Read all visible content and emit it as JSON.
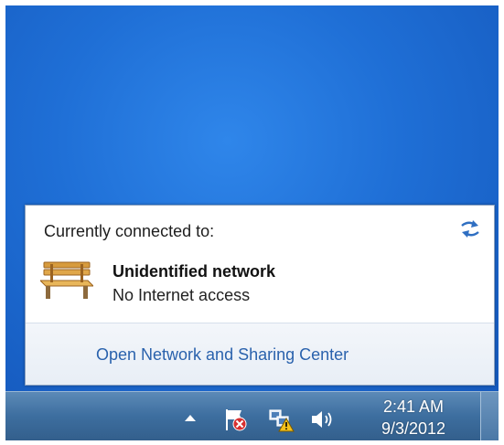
{
  "flyout": {
    "heading": "Currently connected to:",
    "refresh_icon": "refresh-arrows-icon",
    "network": {
      "icon": "bench-icon",
      "name": "Unidentified network",
      "status": "No Internet access"
    },
    "footer_link": "Open Network and Sharing Center"
  },
  "taskbar": {
    "tray_icons": [
      "show-hidden-icons-arrow",
      "action-center-flag-error-icon",
      "network-warning-icon",
      "volume-icon"
    ],
    "clock": {
      "time": "2:41 AM",
      "date": "9/3/2012"
    }
  },
  "colors": {
    "desktop_blue": "#1f6fd6",
    "link_blue": "#2a62ad",
    "taskbar_blue": "#3d6e9f"
  }
}
